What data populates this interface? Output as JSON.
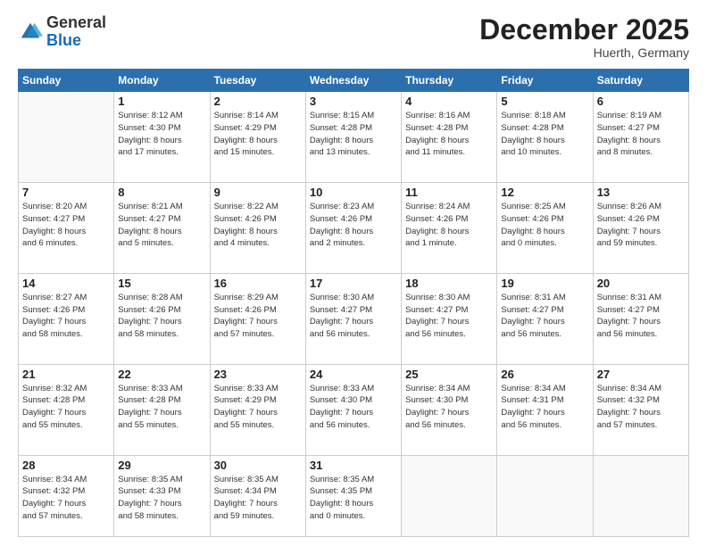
{
  "header": {
    "logo_general": "General",
    "logo_blue": "Blue",
    "month_title": "December 2025",
    "location": "Huerth, Germany"
  },
  "weekdays": [
    "Sunday",
    "Monday",
    "Tuesday",
    "Wednesday",
    "Thursday",
    "Friday",
    "Saturday"
  ],
  "weeks": [
    [
      {
        "day": "",
        "info": ""
      },
      {
        "day": "1",
        "info": "Sunrise: 8:12 AM\nSunset: 4:30 PM\nDaylight: 8 hours\nand 17 minutes."
      },
      {
        "day": "2",
        "info": "Sunrise: 8:14 AM\nSunset: 4:29 PM\nDaylight: 8 hours\nand 15 minutes."
      },
      {
        "day": "3",
        "info": "Sunrise: 8:15 AM\nSunset: 4:28 PM\nDaylight: 8 hours\nand 13 minutes."
      },
      {
        "day": "4",
        "info": "Sunrise: 8:16 AM\nSunset: 4:28 PM\nDaylight: 8 hours\nand 11 minutes."
      },
      {
        "day": "5",
        "info": "Sunrise: 8:18 AM\nSunset: 4:28 PM\nDaylight: 8 hours\nand 10 minutes."
      },
      {
        "day": "6",
        "info": "Sunrise: 8:19 AM\nSunset: 4:27 PM\nDaylight: 8 hours\nand 8 minutes."
      }
    ],
    [
      {
        "day": "7",
        "info": "Sunrise: 8:20 AM\nSunset: 4:27 PM\nDaylight: 8 hours\nand 6 minutes."
      },
      {
        "day": "8",
        "info": "Sunrise: 8:21 AM\nSunset: 4:27 PM\nDaylight: 8 hours\nand 5 minutes."
      },
      {
        "day": "9",
        "info": "Sunrise: 8:22 AM\nSunset: 4:26 PM\nDaylight: 8 hours\nand 4 minutes."
      },
      {
        "day": "10",
        "info": "Sunrise: 8:23 AM\nSunset: 4:26 PM\nDaylight: 8 hours\nand 2 minutes."
      },
      {
        "day": "11",
        "info": "Sunrise: 8:24 AM\nSunset: 4:26 PM\nDaylight: 8 hours\nand 1 minute."
      },
      {
        "day": "12",
        "info": "Sunrise: 8:25 AM\nSunset: 4:26 PM\nDaylight: 8 hours\nand 0 minutes."
      },
      {
        "day": "13",
        "info": "Sunrise: 8:26 AM\nSunset: 4:26 PM\nDaylight: 7 hours\nand 59 minutes."
      }
    ],
    [
      {
        "day": "14",
        "info": "Sunrise: 8:27 AM\nSunset: 4:26 PM\nDaylight: 7 hours\nand 58 minutes."
      },
      {
        "day": "15",
        "info": "Sunrise: 8:28 AM\nSunset: 4:26 PM\nDaylight: 7 hours\nand 58 minutes."
      },
      {
        "day": "16",
        "info": "Sunrise: 8:29 AM\nSunset: 4:26 PM\nDaylight: 7 hours\nand 57 minutes."
      },
      {
        "day": "17",
        "info": "Sunrise: 8:30 AM\nSunset: 4:27 PM\nDaylight: 7 hours\nand 56 minutes."
      },
      {
        "day": "18",
        "info": "Sunrise: 8:30 AM\nSunset: 4:27 PM\nDaylight: 7 hours\nand 56 minutes."
      },
      {
        "day": "19",
        "info": "Sunrise: 8:31 AM\nSunset: 4:27 PM\nDaylight: 7 hours\nand 56 minutes."
      },
      {
        "day": "20",
        "info": "Sunrise: 8:31 AM\nSunset: 4:27 PM\nDaylight: 7 hours\nand 56 minutes."
      }
    ],
    [
      {
        "day": "21",
        "info": "Sunrise: 8:32 AM\nSunset: 4:28 PM\nDaylight: 7 hours\nand 55 minutes."
      },
      {
        "day": "22",
        "info": "Sunrise: 8:33 AM\nSunset: 4:28 PM\nDaylight: 7 hours\nand 55 minutes."
      },
      {
        "day": "23",
        "info": "Sunrise: 8:33 AM\nSunset: 4:29 PM\nDaylight: 7 hours\nand 55 minutes."
      },
      {
        "day": "24",
        "info": "Sunrise: 8:33 AM\nSunset: 4:30 PM\nDaylight: 7 hours\nand 56 minutes."
      },
      {
        "day": "25",
        "info": "Sunrise: 8:34 AM\nSunset: 4:30 PM\nDaylight: 7 hours\nand 56 minutes."
      },
      {
        "day": "26",
        "info": "Sunrise: 8:34 AM\nSunset: 4:31 PM\nDaylight: 7 hours\nand 56 minutes."
      },
      {
        "day": "27",
        "info": "Sunrise: 8:34 AM\nSunset: 4:32 PM\nDaylight: 7 hours\nand 57 minutes."
      }
    ],
    [
      {
        "day": "28",
        "info": "Sunrise: 8:34 AM\nSunset: 4:32 PM\nDaylight: 7 hours\nand 57 minutes."
      },
      {
        "day": "29",
        "info": "Sunrise: 8:35 AM\nSunset: 4:33 PM\nDaylight: 7 hours\nand 58 minutes."
      },
      {
        "day": "30",
        "info": "Sunrise: 8:35 AM\nSunset: 4:34 PM\nDaylight: 7 hours\nand 59 minutes."
      },
      {
        "day": "31",
        "info": "Sunrise: 8:35 AM\nSunset: 4:35 PM\nDaylight: 8 hours\nand 0 minutes."
      },
      {
        "day": "",
        "info": ""
      },
      {
        "day": "",
        "info": ""
      },
      {
        "day": "",
        "info": ""
      }
    ]
  ]
}
